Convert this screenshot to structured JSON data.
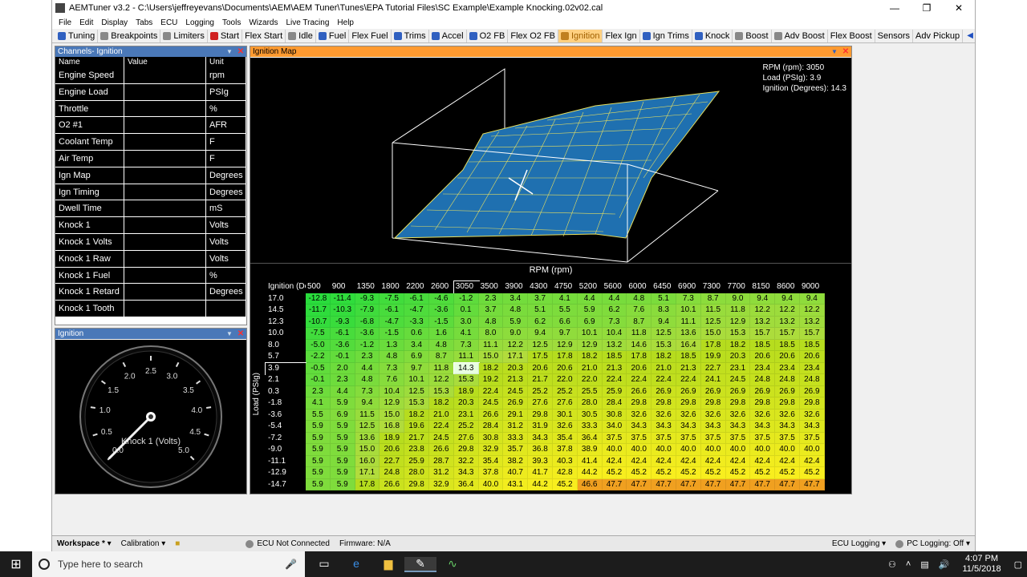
{
  "window": {
    "title": "AEMTuner v3.2 - C:\\Users\\jeffreyevans\\Documents\\AEM\\AEM Tuner\\Tunes\\EPA Tutorial Files\\SC Example\\Example Knocking.02v02.cal",
    "min": "—",
    "max": "❐",
    "close": "✕"
  },
  "menu": [
    "File",
    "Edit",
    "Display",
    "Tabs",
    "ECU",
    "Logging",
    "Tools",
    "Wizards",
    "Live Tracing",
    "Help"
  ],
  "tabs": [
    {
      "label": "Tuning",
      "color": "#3060c0"
    },
    {
      "label": "Breakpoints",
      "color": "#888"
    },
    {
      "label": "Limiters",
      "color": "#888"
    },
    {
      "label": "Start",
      "color": "#d02020"
    },
    {
      "label": "Flex Start",
      "color": ""
    },
    {
      "label": "Idle",
      "color": "#888"
    },
    {
      "label": "Fuel",
      "color": "#3060c0"
    },
    {
      "label": "Flex Fuel",
      "color": ""
    },
    {
      "label": "Trims",
      "color": "#3060c0"
    },
    {
      "label": "Accel",
      "color": "#3060c0"
    },
    {
      "label": "O2 FB",
      "color": "#3060c0"
    },
    {
      "label": "Flex O2 FB",
      "color": ""
    },
    {
      "label": "Ignition",
      "color": "#c08020",
      "active": true
    },
    {
      "label": "Flex Ign",
      "color": ""
    },
    {
      "label": "Ign Trims",
      "color": "#3060c0"
    },
    {
      "label": "Knock",
      "color": "#3060c0"
    },
    {
      "label": "Boost",
      "color": "#888"
    },
    {
      "label": "Adv Boost",
      "color": "#888"
    },
    {
      "label": "Flex Boost",
      "color": ""
    },
    {
      "label": "Sensors",
      "color": ""
    },
    {
      "label": "Adv Pickup",
      "color": ""
    }
  ],
  "channels": {
    "title": "Channels- Ignition",
    "headers": [
      "Name",
      "Value",
      "Unit"
    ],
    "rows": [
      [
        "Engine Speed",
        "",
        "rpm"
      ],
      [
        "Engine Load",
        "",
        "PSIg"
      ],
      [
        "Throttle",
        "",
        "%"
      ],
      [
        "O2 #1",
        "",
        "AFR"
      ],
      [
        "Coolant Temp",
        "",
        "F"
      ],
      [
        "Air Temp",
        "",
        "F"
      ],
      [
        "Ign Map",
        "",
        "Degrees"
      ],
      [
        "Ign Timing",
        "",
        "Degrees"
      ],
      [
        "Dwell Time",
        "",
        "mS"
      ],
      [
        "Knock 1",
        "",
        "Volts"
      ],
      [
        "Knock 1 Volts",
        "",
        "Volts"
      ],
      [
        "Knock 1 Raw",
        "",
        "Volts"
      ],
      [
        "Knock 1 Fuel",
        "",
        "%"
      ],
      [
        "Knock 1 Retard",
        "",
        "Degrees"
      ],
      [
        "Knock 1 Tooth",
        "",
        ""
      ]
    ]
  },
  "gauge": {
    "title": "Ignition",
    "label": "Knock 1 (Volts)",
    "ticks": [
      "0.0",
      "0.5",
      "1.0",
      "1.5",
      "2.0",
      "2.5",
      "3.0",
      "3.5",
      "4.0",
      "4.5",
      "5.0"
    ],
    "value": 0.0
  },
  "map": {
    "title": "Ignition Map",
    "readout": [
      "RPM (rpm): 3050",
      "Load (PSIg): 3.9",
      "Ignition (Degrees): 14.3"
    ],
    "x_axis_label": "RPM (rpm)",
    "y_axis_label": "Load (PSIg)",
    "corner_label": "Ignition (Degrees)",
    "rpm": [
      "500",
      "900",
      "1350",
      "1800",
      "2200",
      "2600",
      "3050",
      "3500",
      "3900",
      "4300",
      "4750",
      "5200",
      "5600",
      "6000",
      "6450",
      "6900",
      "7300",
      "7700",
      "8150",
      "8600",
      "9000"
    ],
    "load": [
      "17.0",
      "14.5",
      "12.3",
      "10.0",
      "8.0",
      "5.7",
      "3.9",
      "2.1",
      "0.3",
      "-1.8",
      "-3.6",
      "-5.4",
      "-7.2",
      "-9.0",
      "-11.1",
      "-12.9",
      "-14.7"
    ],
    "values": [
      [
        "-12.8",
        "-11.4",
        "-9.3",
        "-7.5",
        "-6.1",
        "-4.6",
        "-1.2",
        "2.3",
        "3.4",
        "3.7",
        "4.1",
        "4.4",
        "4.4",
        "4.8",
        "5.1",
        "7.3",
        "8.7",
        "9.0",
        "9.4",
        "9.4",
        "9.4"
      ],
      [
        "-11.7",
        "-10.3",
        "-7.9",
        "-6.1",
        "-4.7",
        "-3.6",
        "0.1",
        "3.7",
        "4.8",
        "5.1",
        "5.5",
        "5.9",
        "6.2",
        "7.6",
        "8.3",
        "10.1",
        "11.5",
        "11.8",
        "12.2",
        "12.2",
        "12.2"
      ],
      [
        "-10.7",
        "-9.3",
        "-6.8",
        "-4.7",
        "-3.3",
        "-1.5",
        "3.0",
        "4.8",
        "5.9",
        "6.2",
        "6.6",
        "6.9",
        "7.3",
        "8.7",
        "9.4",
        "11.1",
        "12.5",
        "12.9",
        "13.2",
        "13.2",
        "13.2"
      ],
      [
        "-7.5",
        "-6.1",
        "-3.6",
        "-1.5",
        "0.6",
        "1.6",
        "4.1",
        "8.0",
        "9.0",
        "9.4",
        "9.7",
        "10.1",
        "10.4",
        "11.8",
        "12.5",
        "13.6",
        "15.0",
        "15.3",
        "15.7",
        "15.7",
        "15.7"
      ],
      [
        "-5.0",
        "-3.6",
        "-1.2",
        "1.3",
        "3.4",
        "4.8",
        "7.3",
        "11.1",
        "12.2",
        "12.5",
        "12.9",
        "12.9",
        "13.2",
        "14.6",
        "15.3",
        "16.4",
        "17.8",
        "18.2",
        "18.5",
        "18.5",
        "18.5"
      ],
      [
        "-2.2",
        "-0.1",
        "2.3",
        "4.8",
        "6.9",
        "8.7",
        "11.1",
        "15.0",
        "17.1",
        "17.5",
        "17.8",
        "18.2",
        "18.5",
        "17.8",
        "18.2",
        "18.5",
        "19.9",
        "20.3",
        "20.6",
        "20.6",
        "20.6"
      ],
      [
        "-0.5",
        "2.0",
        "4.4",
        "7.3",
        "9.7",
        "11.8",
        "14.3",
        "18.2",
        "20.3",
        "20.6",
        "20.6",
        "21.0",
        "21.3",
        "20.6",
        "21.0",
        "21.3",
        "22.7",
        "23.1",
        "23.4",
        "23.4",
        "23.4"
      ],
      [
        "-0.1",
        "2.3",
        "4.8",
        "7.6",
        "10.1",
        "12.2",
        "15.3",
        "19.2",
        "21.3",
        "21.7",
        "22.0",
        "22.0",
        "22.4",
        "22.4",
        "22.4",
        "22.4",
        "24.1",
        "24.5",
        "24.8",
        "24.8",
        "24.8"
      ],
      [
        "2.3",
        "4.4",
        "7.3",
        "10.4",
        "12.5",
        "15.3",
        "18.9",
        "22.4",
        "24.5",
        "25.2",
        "25.2",
        "25.5",
        "25.9",
        "26.6",
        "26.9",
        "26.9",
        "26.9",
        "26.9",
        "26.9",
        "26.9",
        "26.9"
      ],
      [
        "4.1",
        "5.9",
        "9.4",
        "12.9",
        "15.3",
        "18.2",
        "20.3",
        "24.5",
        "26.9",
        "27.6",
        "27.6",
        "28.0",
        "28.4",
        "29.8",
        "29.8",
        "29.8",
        "29.8",
        "29.8",
        "29.8",
        "29.8",
        "29.8"
      ],
      [
        "5.5",
        "6.9",
        "11.5",
        "15.0",
        "18.2",
        "21.0",
        "23.1",
        "26.6",
        "29.1",
        "29.8",
        "30.1",
        "30.5",
        "30.8",
        "32.6",
        "32.6",
        "32.6",
        "32.6",
        "32.6",
        "32.6",
        "32.6",
        "32.6"
      ],
      [
        "5.9",
        "5.9",
        "12.5",
        "16.8",
        "19.6",
        "22.4",
        "25.2",
        "28.4",
        "31.2",
        "31.9",
        "32.6",
        "33.3",
        "34.0",
        "34.3",
        "34.3",
        "34.3",
        "34.3",
        "34.3",
        "34.3",
        "34.3",
        "34.3"
      ],
      [
        "5.9",
        "5.9",
        "13.6",
        "18.9",
        "21.7",
        "24.5",
        "27.6",
        "30.8",
        "33.3",
        "34.3",
        "35.4",
        "36.4",
        "37.5",
        "37.5",
        "37.5",
        "37.5",
        "37.5",
        "37.5",
        "37.5",
        "37.5",
        "37.5"
      ],
      [
        "5.9",
        "5.9",
        "15.0",
        "20.6",
        "23.8",
        "26.6",
        "29.8",
        "32.9",
        "35.7",
        "36.8",
        "37.8",
        "38.9",
        "40.0",
        "40.0",
        "40.0",
        "40.0",
        "40.0",
        "40.0",
        "40.0",
        "40.0",
        "40.0"
      ],
      [
        "5.9",
        "5.9",
        "16.0",
        "22.7",
        "25.9",
        "28.7",
        "32.2",
        "35.4",
        "38.2",
        "39.3",
        "40.3",
        "41.4",
        "42.4",
        "42.4",
        "42.4",
        "42.4",
        "42.4",
        "42.4",
        "42.4",
        "42.4",
        "42.4"
      ],
      [
        "5.9",
        "5.9",
        "17.1",
        "24.8",
        "28.0",
        "31.2",
        "34.3",
        "37.8",
        "40.7",
        "41.7",
        "42.8",
        "44.2",
        "45.2",
        "45.2",
        "45.2",
        "45.2",
        "45.2",
        "45.2",
        "45.2",
        "45.2",
        "45.2"
      ],
      [
        "5.9",
        "5.9",
        "17.8",
        "26.6",
        "29.8",
        "32.9",
        "36.4",
        "40.0",
        "43.1",
        "44.2",
        "45.2",
        "46.6",
        "47.7",
        "47.7",
        "47.7",
        "47.7",
        "47.7",
        "47.7",
        "47.7",
        "47.7",
        "47.7"
      ]
    ]
  },
  "statusbar": {
    "workspace": "Workspace *",
    "calibration": "Calibration",
    "ecu": "ECU Not Connected",
    "firmware": "Firmware: N/A",
    "ecu_logging": "ECU Logging",
    "pc_logging": "PC Logging: Off"
  },
  "taskbar": {
    "search_placeholder": "Type here to search",
    "time": "4:07 PM",
    "date": "11/5/2018"
  }
}
